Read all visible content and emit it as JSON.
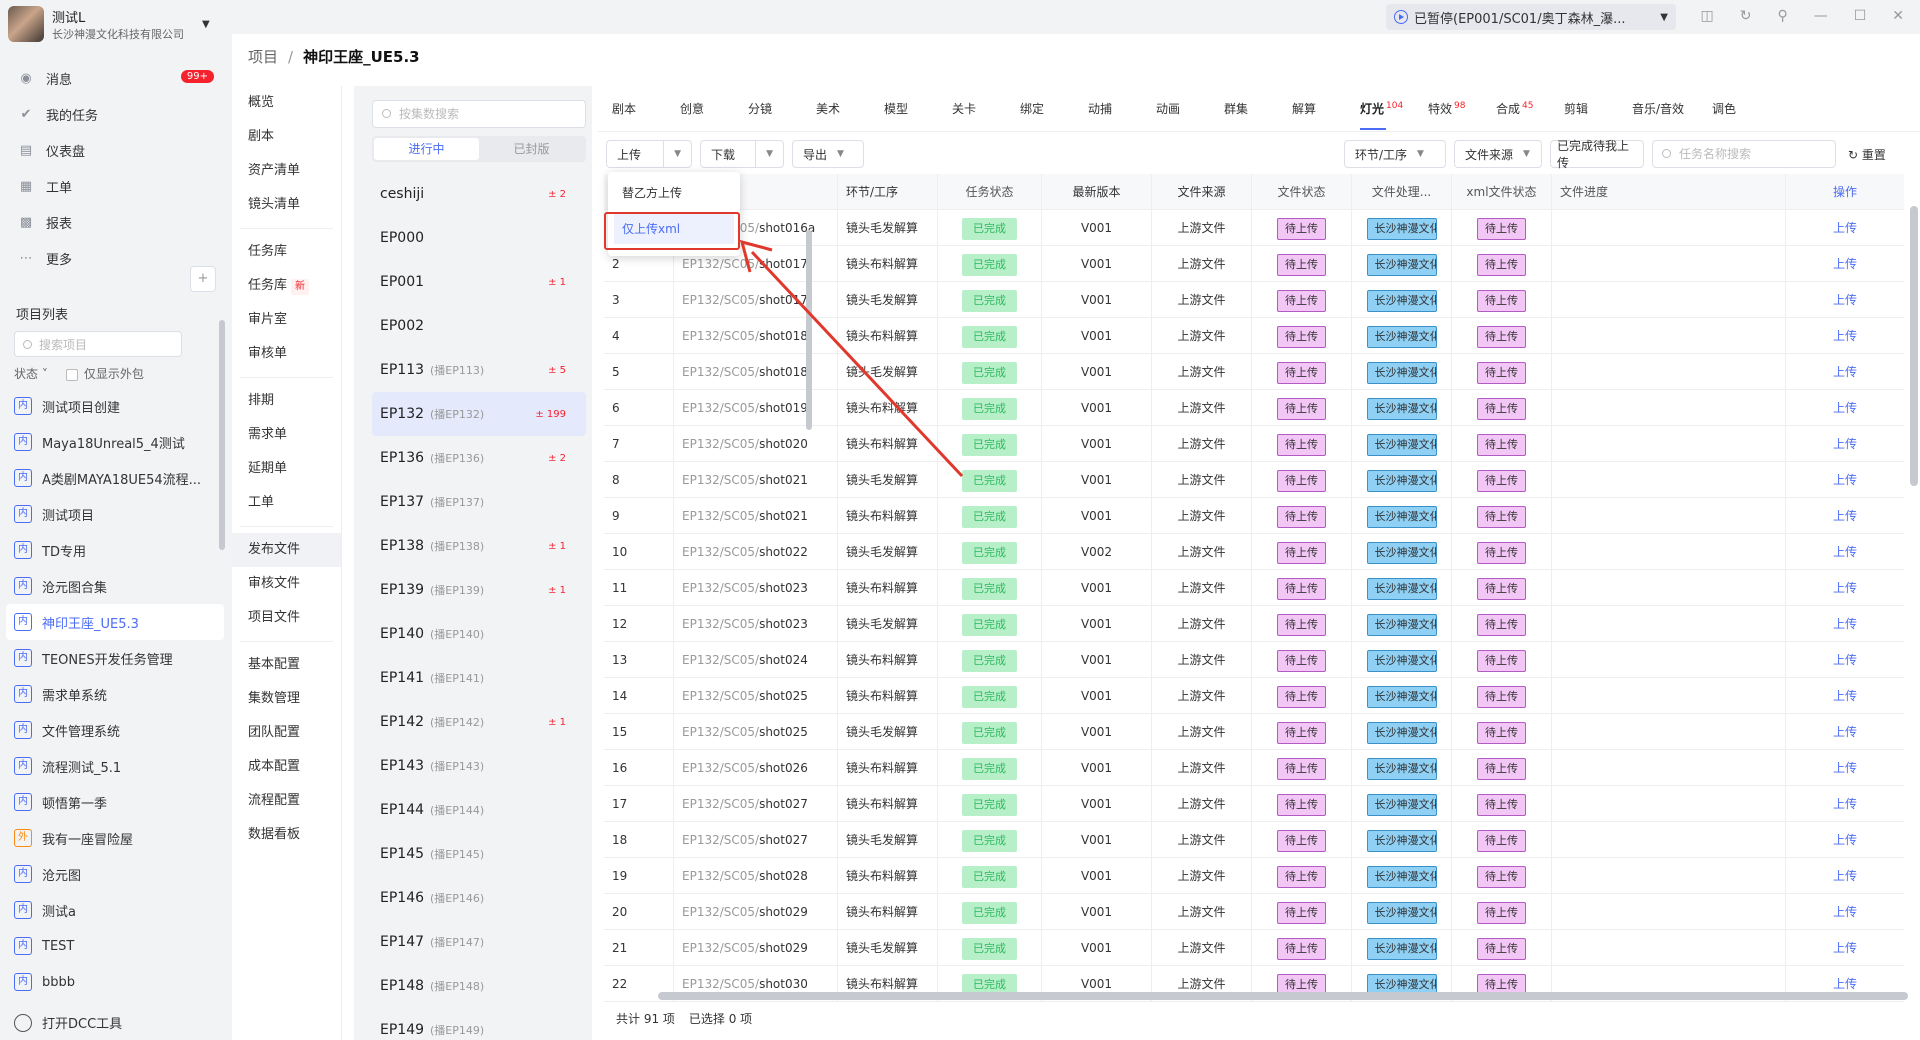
{
  "user": {
    "name": "测试L",
    "org": "长沙神漫文化科技有限公司"
  },
  "topbar": {
    "paused_text": "已暂停(EP001/SC01/奥丁森林_瀑..."
  },
  "nav": [
    {
      "icon": "bell-icon",
      "label": "消息",
      "badge": "99+"
    },
    {
      "icon": "check-icon",
      "label": "我的任务"
    },
    {
      "icon": "dashboard-icon",
      "label": "仪表盘"
    },
    {
      "icon": "ticket-icon",
      "label": "工单"
    },
    {
      "icon": "report-icon",
      "label": "报表"
    },
    {
      "icon": "more-icon",
      "label": "更多"
    }
  ],
  "projects": {
    "title": "项目列表",
    "search_placeholder": "搜索项目",
    "filter_status": "状态",
    "filter_outsource": "仅显示外包",
    "items": [
      {
        "tag": "内",
        "label": "测试项目创建"
      },
      {
        "tag": "内",
        "label": "Maya18Unreal5_4测试"
      },
      {
        "tag": "内",
        "label": "A类剧MAYA18UE54流程..."
      },
      {
        "tag": "内",
        "label": "测试项目"
      },
      {
        "tag": "内",
        "label": "TD专用"
      },
      {
        "tag": "内",
        "label": "沧元图合集"
      },
      {
        "tag": "内",
        "label": "神印王座_UE5.3"
      },
      {
        "tag": "内",
        "label": "TEONES开发任务管理"
      },
      {
        "tag": "内",
        "label": "需求单系统"
      },
      {
        "tag": "内",
        "label": "文件管理系统"
      },
      {
        "tag": "内",
        "label": "流程测试_5.1"
      },
      {
        "tag": "内",
        "label": "顿悟第一季"
      },
      {
        "tag": "外",
        "label": "我有一座冒险屋"
      },
      {
        "tag": "内",
        "label": "沧元图"
      },
      {
        "tag": "内",
        "label": "测试a"
      },
      {
        "tag": "内",
        "label": "TEST"
      },
      {
        "tag": "内",
        "label": "bbbb"
      }
    ],
    "dcc_label": "打开DCC工具"
  },
  "breadcrumb": {
    "root": "项目",
    "sep": "/",
    "current": "神印王座_UE5.3"
  },
  "submenu": [
    [
      "概览",
      "剧本",
      "资产清单",
      "镜头清单"
    ],
    [
      "任务库",
      "任务库",
      "审片室",
      "审核单"
    ],
    [
      "排期",
      "需求单",
      "延期单",
      "工单"
    ],
    [
      "发布文件",
      "审核文件",
      "项目文件"
    ],
    [
      "基本配置",
      "集数管理",
      "团队配置",
      "成本配置",
      "流程配置",
      "数据看板"
    ]
  ],
  "submenu_new": "新",
  "episodes": {
    "search_placeholder": "按集数搜索",
    "tab_active": "进行中",
    "tab_closed": "已封版",
    "items": [
      {
        "name": "ceshiji",
        "sub": "",
        "count": "± 2"
      },
      {
        "name": "EP000",
        "sub": "",
        "count": ""
      },
      {
        "name": "EP001",
        "sub": "",
        "count": "± 1"
      },
      {
        "name": "EP002",
        "sub": "",
        "count": ""
      },
      {
        "name": "EP113",
        "sub": "(播EP113)",
        "count": "± 5"
      },
      {
        "name": "EP132",
        "sub": "(播EP132)",
        "count": "± 199"
      },
      {
        "name": "EP136",
        "sub": "(播EP136)",
        "count": "± 2"
      },
      {
        "name": "EP137",
        "sub": "(播EP137)",
        "count": ""
      },
      {
        "name": "EP138",
        "sub": "(播EP138)",
        "count": "± 1"
      },
      {
        "name": "EP139",
        "sub": "(播EP139)",
        "count": "± 1"
      },
      {
        "name": "EP140",
        "sub": "(播EP140)",
        "count": ""
      },
      {
        "name": "EP141",
        "sub": "(播EP141)",
        "count": ""
      },
      {
        "name": "EP142",
        "sub": "(播EP142)",
        "count": "± 1"
      },
      {
        "name": "EP143",
        "sub": "(播EP143)",
        "count": ""
      },
      {
        "name": "EP144",
        "sub": "(播EP144)",
        "count": ""
      },
      {
        "name": "EP145",
        "sub": "(播EP145)",
        "count": ""
      },
      {
        "name": "EP146",
        "sub": "(播EP146)",
        "count": ""
      },
      {
        "name": "EP147",
        "sub": "(播EP147)",
        "count": ""
      },
      {
        "name": "EP148",
        "sub": "(播EP148)",
        "count": ""
      },
      {
        "name": "EP149",
        "sub": "(播EP149)",
        "count": ""
      }
    ]
  },
  "dept_tabs": [
    {
      "label": "剧本",
      "count": ""
    },
    {
      "label": "创意",
      "count": ""
    },
    {
      "label": "分镜",
      "count": ""
    },
    {
      "label": "美术",
      "count": ""
    },
    {
      "label": "模型",
      "count": ""
    },
    {
      "label": "关卡",
      "count": ""
    },
    {
      "label": "绑定",
      "count": ""
    },
    {
      "label": "动捕",
      "count": ""
    },
    {
      "label": "动画",
      "count": ""
    },
    {
      "label": "群集",
      "count": ""
    },
    {
      "label": "解算",
      "count": ""
    },
    {
      "label": "灯光",
      "count": "104"
    },
    {
      "label": "特效",
      "count": "98"
    },
    {
      "label": "合成",
      "count": "45"
    },
    {
      "label": "剪辑",
      "count": ""
    },
    {
      "label": "音乐/音效",
      "count": ""
    },
    {
      "label": "调色",
      "count": ""
    }
  ],
  "toolbar": {
    "upload": "上传",
    "download": "下载",
    "export": "导出",
    "filter_step": "环节/工序",
    "filter_source": "文件来源",
    "filter_done": "已完成待我上传",
    "search_placeholder": "任务名称搜索",
    "reset": "重置"
  },
  "dropdown": {
    "item1": "替乙方上传",
    "item2": "仅上传xml"
  },
  "table": {
    "headers": [
      "",
      "",
      "环节/工序",
      "任务状态",
      "最新版本",
      "文件来源",
      "文件状态",
      "文件处理...",
      "xml文件状态",
      "文件进度",
      "操作"
    ],
    "rows": [
      {
        "idx": "1",
        "shot_prefix": "EP132/SC05/",
        "shot": "shot016a",
        "step": "镜头毛发解算",
        "status": "已完成",
        "ver": "V001",
        "src": "上游文件",
        "fstat": "待上传",
        "proc": "长沙神漫文化",
        "xml": "待上传",
        "op": "上传"
      },
      {
        "idx": "2",
        "shot_prefix": "EP132/SC05/",
        "shot": "shot017",
        "step": "镜头布料解算",
        "status": "已完成",
        "ver": "V001",
        "src": "上游文件",
        "fstat": "待上传",
        "proc": "长沙神漫文化",
        "xml": "待上传",
        "op": "上传"
      },
      {
        "idx": "3",
        "shot_prefix": "EP132/SC05/",
        "shot": "shot017",
        "step": "镜头毛发解算",
        "status": "已完成",
        "ver": "V001",
        "src": "上游文件",
        "fstat": "待上传",
        "proc": "长沙神漫文化",
        "xml": "待上传",
        "op": "上传"
      },
      {
        "idx": "4",
        "shot_prefix": "EP132/SC05/",
        "shot": "shot018",
        "step": "镜头布料解算",
        "status": "已完成",
        "ver": "V001",
        "src": "上游文件",
        "fstat": "待上传",
        "proc": "长沙神漫文化",
        "xml": "待上传",
        "op": "上传"
      },
      {
        "idx": "5",
        "shot_prefix": "EP132/SC05/",
        "shot": "shot018",
        "step": "镜头毛发解算",
        "status": "已完成",
        "ver": "V001",
        "src": "上游文件",
        "fstat": "待上传",
        "proc": "长沙神漫文化",
        "xml": "待上传",
        "op": "上传"
      },
      {
        "idx": "6",
        "shot_prefix": "EP132/SC05/",
        "shot": "shot019",
        "step": "镜头布料解算",
        "status": "已完成",
        "ver": "V001",
        "src": "上游文件",
        "fstat": "待上传",
        "proc": "长沙神漫文化",
        "xml": "待上传",
        "op": "上传"
      },
      {
        "idx": "7",
        "shot_prefix": "EP132/SC05/",
        "shot": "shot020",
        "step": "镜头布料解算",
        "status": "已完成",
        "ver": "V001",
        "src": "上游文件",
        "fstat": "待上传",
        "proc": "长沙神漫文化",
        "xml": "待上传",
        "op": "上传"
      },
      {
        "idx": "8",
        "shot_prefix": "EP132/SC05/",
        "shot": "shot021",
        "step": "镜头毛发解算",
        "status": "已完成",
        "ver": "V001",
        "src": "上游文件",
        "fstat": "待上传",
        "proc": "长沙神漫文化",
        "xml": "待上传",
        "op": "上传"
      },
      {
        "idx": "9",
        "shot_prefix": "EP132/SC05/",
        "shot": "shot021",
        "step": "镜头布料解算",
        "status": "已完成",
        "ver": "V001",
        "src": "上游文件",
        "fstat": "待上传",
        "proc": "长沙神漫文化",
        "xml": "待上传",
        "op": "上传"
      },
      {
        "idx": "10",
        "shot_prefix": "EP132/SC05/",
        "shot": "shot022",
        "step": "镜头毛发解算",
        "status": "已完成",
        "ver": "V002",
        "src": "上游文件",
        "fstat": "待上传",
        "proc": "长沙神漫文化",
        "xml": "待上传",
        "op": "上传"
      },
      {
        "idx": "11",
        "shot_prefix": "EP132/SC05/",
        "shot": "shot023",
        "step": "镜头布料解算",
        "status": "已完成",
        "ver": "V001",
        "src": "上游文件",
        "fstat": "待上传",
        "proc": "长沙神漫文化",
        "xml": "待上传",
        "op": "上传"
      },
      {
        "idx": "12",
        "shot_prefix": "EP132/SC05/",
        "shot": "shot023",
        "step": "镜头毛发解算",
        "status": "已完成",
        "ver": "V001",
        "src": "上游文件",
        "fstat": "待上传",
        "proc": "长沙神漫文化",
        "xml": "待上传",
        "op": "上传"
      },
      {
        "idx": "13",
        "shot_prefix": "EP132/SC05/",
        "shot": "shot024",
        "step": "镜头布料解算",
        "status": "已完成",
        "ver": "V001",
        "src": "上游文件",
        "fstat": "待上传",
        "proc": "长沙神漫文化",
        "xml": "待上传",
        "op": "上传"
      },
      {
        "idx": "14",
        "shot_prefix": "EP132/SC05/",
        "shot": "shot025",
        "step": "镜头布料解算",
        "status": "已完成",
        "ver": "V001",
        "src": "上游文件",
        "fstat": "待上传",
        "proc": "长沙神漫文化",
        "xml": "待上传",
        "op": "上传"
      },
      {
        "idx": "15",
        "shot_prefix": "EP132/SC05/",
        "shot": "shot025",
        "step": "镜头毛发解算",
        "status": "已完成",
        "ver": "V001",
        "src": "上游文件",
        "fstat": "待上传",
        "proc": "长沙神漫文化",
        "xml": "待上传",
        "op": "上传"
      },
      {
        "idx": "16",
        "shot_prefix": "EP132/SC05/",
        "shot": "shot026",
        "step": "镜头布料解算",
        "status": "已完成",
        "ver": "V001",
        "src": "上游文件",
        "fstat": "待上传",
        "proc": "长沙神漫文化",
        "xml": "待上传",
        "op": "上传"
      },
      {
        "idx": "17",
        "shot_prefix": "EP132/SC05/",
        "shot": "shot027",
        "step": "镜头布料解算",
        "status": "已完成",
        "ver": "V001",
        "src": "上游文件",
        "fstat": "待上传",
        "proc": "长沙神漫文化",
        "xml": "待上传",
        "op": "上传"
      },
      {
        "idx": "18",
        "shot_prefix": "EP132/SC05/",
        "shot": "shot027",
        "step": "镜头毛发解算",
        "status": "已完成",
        "ver": "V001",
        "src": "上游文件",
        "fstat": "待上传",
        "proc": "长沙神漫文化",
        "xml": "待上传",
        "op": "上传"
      },
      {
        "idx": "19",
        "shot_prefix": "EP132/SC05/",
        "shot": "shot028",
        "step": "镜头布料解算",
        "status": "已完成",
        "ver": "V001",
        "src": "上游文件",
        "fstat": "待上传",
        "proc": "长沙神漫文化",
        "xml": "待上传",
        "op": "上传"
      },
      {
        "idx": "20",
        "shot_prefix": "EP132/SC05/",
        "shot": "shot029",
        "step": "镜头布料解算",
        "status": "已完成",
        "ver": "V001",
        "src": "上游文件",
        "fstat": "待上传",
        "proc": "长沙神漫文化",
        "xml": "待上传",
        "op": "上传"
      },
      {
        "idx": "21",
        "shot_prefix": "EP132/SC05/",
        "shot": "shot029",
        "step": "镜头毛发解算",
        "status": "已完成",
        "ver": "V001",
        "src": "上游文件",
        "fstat": "待上传",
        "proc": "长沙神漫文化",
        "xml": "待上传",
        "op": "上传"
      },
      {
        "idx": "22",
        "shot_prefix": "EP132/SC05/",
        "shot": "shot030",
        "step": "镜头布料解算",
        "status": "已完成",
        "ver": "V001",
        "src": "上游文件",
        "fstat": "待上传",
        "proc": "长沙神漫文化",
        "xml": "待上传",
        "op": "上传"
      }
    ]
  },
  "footer": {
    "total": "共计 91 项",
    "selected": "已选择 0 项"
  },
  "colors": {
    "accent": "#4a6cf7",
    "done": "#2fb862",
    "pending_bg": "#f2c6f5",
    "org_bg": "#8fd0f5",
    "highlight_box": "#e0382d"
  }
}
